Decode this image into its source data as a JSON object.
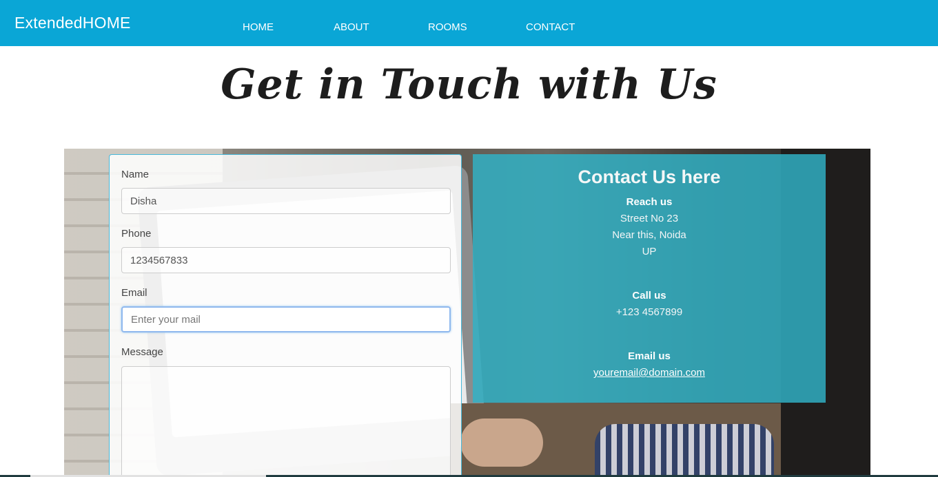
{
  "nav": {
    "brand": "ExtendedHOME",
    "links": [
      "HOME",
      "ABOUT",
      "ROOMS",
      "CONTACT"
    ]
  },
  "page_title": "Get in Touch with Us",
  "form": {
    "name_label": "Name",
    "name_value": "Disha",
    "phone_label": "Phone",
    "phone_value": "1234567833",
    "email_label": "Email",
    "email_placeholder": "Enter your mail",
    "message_label": "Message"
  },
  "contact": {
    "title": "Contact Us here",
    "reach_heading": "Reach us",
    "address_lines": [
      "Street No 23",
      "Near this, Noida",
      "UP"
    ],
    "call_heading": "Call us",
    "phone": "+123 4567899",
    "email_heading": "Email us",
    "email": "youremail@domain.com"
  },
  "colors": {
    "navbar": "#0aa6d6",
    "contact_panel": "#30b2c7",
    "form_border": "#46b8da"
  }
}
